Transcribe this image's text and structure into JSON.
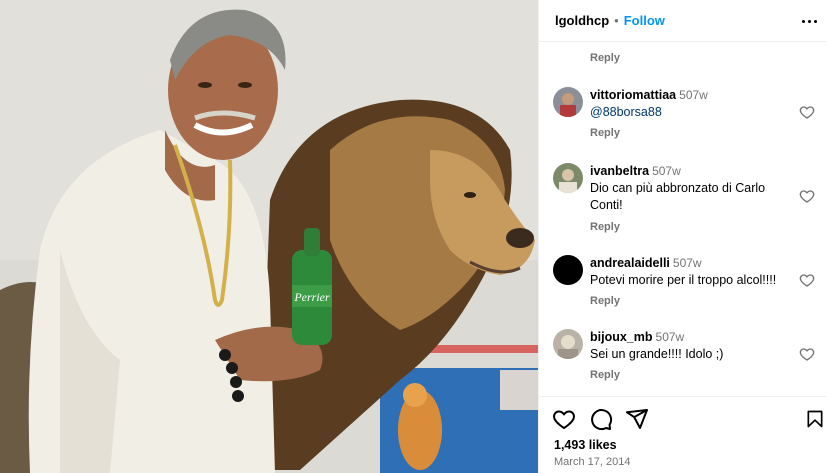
{
  "post": {
    "username": "lgoldhcp",
    "follow_label": "Follow",
    "separator": "•"
  },
  "top_reply_label": "Reply",
  "comments": [
    {
      "author": "vittoriomattiaa",
      "time": "507w",
      "text": "@88borsa88",
      "reply_label": "Reply",
      "avatar_color": "#8a8f98"
    },
    {
      "author": "ivanbeltra",
      "time": "507w",
      "text": "Dio can più abbronzato di Carlo Conti!",
      "reply_label": "Reply",
      "avatar_color": "#7c8a6a"
    },
    {
      "author": "andrealaidelli",
      "time": "507w",
      "text": "Potevi morire per il troppo alcol!!!!",
      "reply_label": "Reply",
      "avatar_color": "#000000"
    },
    {
      "author": "bijoux_mb",
      "time": "507w",
      "text": "Sei un grande!!!! Idolo ;)",
      "reply_label": "Reply",
      "avatar_color": "#b9b2a6"
    }
  ],
  "footer": {
    "likes": "1,493 likes",
    "date": "March 17, 2014"
  },
  "icons": {
    "like": "heart-icon",
    "comment": "comment-icon",
    "share": "share-icon",
    "save": "bookmark-icon",
    "more": "more-options-icon"
  },
  "colors": {
    "link_blue": "#0095f6",
    "muted_text": "#737373",
    "divider": "#efefef"
  }
}
